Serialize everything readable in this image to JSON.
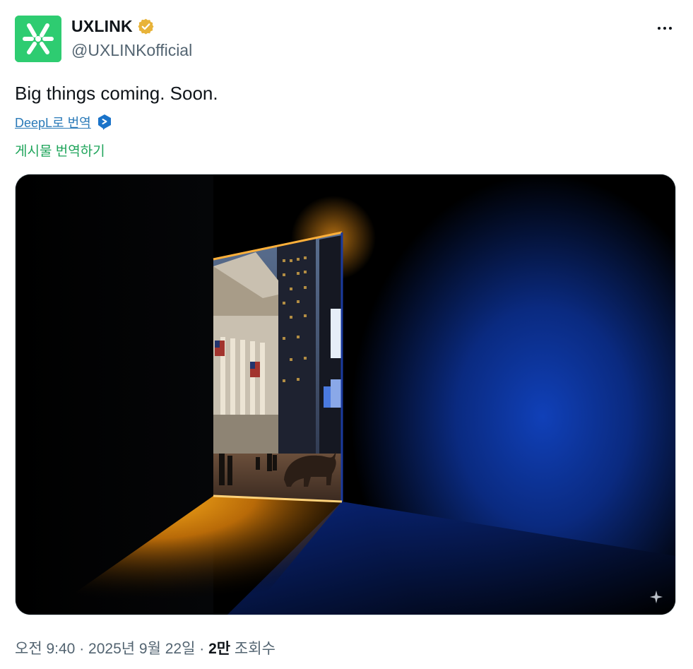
{
  "account": {
    "display_name": "UXLINK",
    "handle": "@UXLINKofficial",
    "verified": true,
    "avatar_color": "#2ecc71",
    "verified_color": "#e8b339"
  },
  "post": {
    "text": "Big things coming. Soon.",
    "deepl_link": "DeepL로 번역",
    "translate_link": "게시물 번역하기",
    "media_icon": "sparkle-icon"
  },
  "meta": {
    "time": "오전 9:40",
    "sep1": " · ",
    "date": "2025년 9월 22일",
    "sep2": " · ",
    "views_count": "2만",
    "views_label": " 조회수"
  },
  "colors": {
    "link_blue": "#2a7ab8",
    "translate_green": "#1ea45a",
    "muted": "#536471"
  }
}
